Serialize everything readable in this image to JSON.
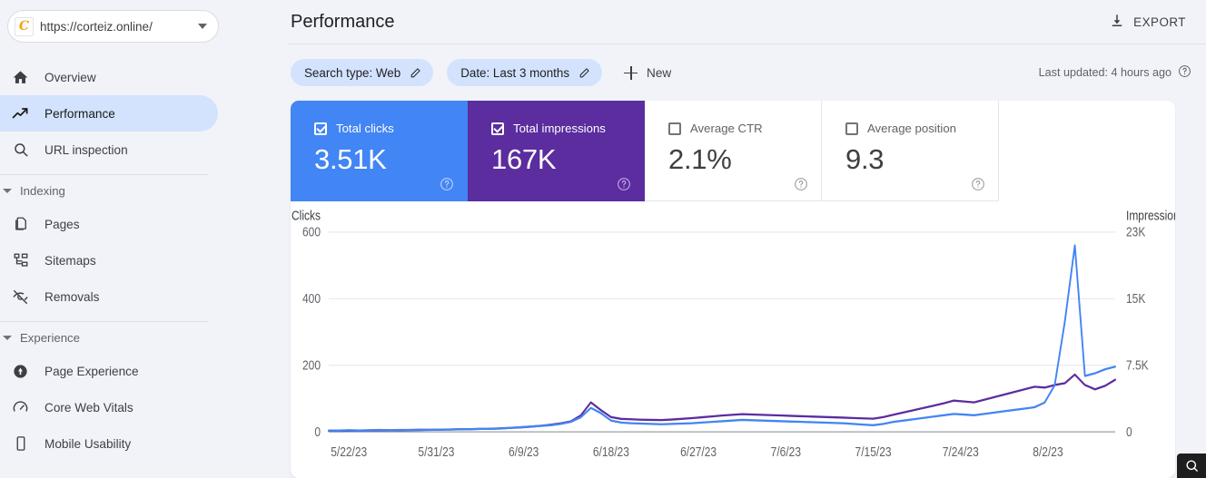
{
  "sidebar": {
    "property": {
      "url": "https://corteiz.online/",
      "favicon_letter": "C",
      "dropdown_icon": "chevron-down-icon"
    },
    "items": [
      {
        "label": "Overview",
        "icon": "home-icon",
        "active": false
      },
      {
        "label": "Performance",
        "icon": "trending-up-icon",
        "active": true
      },
      {
        "label": "URL inspection",
        "icon": "search-icon",
        "active": false
      }
    ],
    "groups": [
      {
        "label": "Indexing",
        "items": [
          {
            "label": "Pages",
            "icon": "pages-icon"
          },
          {
            "label": "Sitemaps",
            "icon": "sitemap-icon"
          },
          {
            "label": "Removals",
            "icon": "eye-off-icon"
          }
        ]
      },
      {
        "label": "Experience",
        "items": [
          {
            "label": "Page Experience",
            "icon": "page-experience-icon"
          },
          {
            "label": "Core Web Vitals",
            "icon": "speedometer-icon"
          },
          {
            "label": "Mobile Usability",
            "icon": "mobile-icon"
          }
        ]
      }
    ]
  },
  "header": {
    "title": "Performance",
    "export_label": "EXPORT",
    "export_icon": "download-icon"
  },
  "filters": {
    "chips": [
      {
        "label": "Search type: Web",
        "icon": "pencil-icon"
      },
      {
        "label": "Date: Last 3 months",
        "icon": "pencil-icon"
      }
    ],
    "new_label": "New",
    "new_icon": "plus-icon",
    "last_updated": "Last updated: 4 hours ago",
    "help_icon": "help-circle-icon"
  },
  "metrics": [
    {
      "label": "Total clicks",
      "value": "3.51K",
      "checked": true,
      "state": "sel-blue"
    },
    {
      "label": "Total impressions",
      "value": "167K",
      "checked": true,
      "state": "sel-purple"
    },
    {
      "label": "Average CTR",
      "value": "2.1%",
      "checked": false,
      "state": ""
    },
    {
      "label": "Average position",
      "value": "9.3",
      "checked": false,
      "state": ""
    }
  ],
  "colors": {
    "clicks": "#4285F4",
    "impressions": "#5B2D9E",
    "card_blue": "#4285F4",
    "card_purple": "#5B2D9E",
    "chip_bg": "#D3E3FD",
    "page_bg": "#F1F3F9"
  },
  "chart_data": {
    "type": "line",
    "title": "",
    "ylabel": "Clicks",
    "y2label": "Impressions",
    "xlabel": "",
    "ylim": [
      0,
      600
    ],
    "y2lim": [
      0,
      23000
    ],
    "yticks": [
      "0",
      "200",
      "400",
      "600"
    ],
    "y2ticks": [
      "0",
      "7.5K",
      "15K",
      "23K"
    ],
    "grid": true,
    "legend": "none",
    "xticks": [
      "5/22/23",
      "5/31/23",
      "6/9/23",
      "6/18/23",
      "6/27/23",
      "7/6/23",
      "7/15/23",
      "7/24/23",
      "8/2/23"
    ],
    "x_start": "5/22/23",
    "x_end": "8/8/23",
    "n_points": 79,
    "series": [
      {
        "name": "Clicks",
        "color": "#4285F4",
        "axis": "left",
        "values": [
          4,
          4,
          5,
          4,
          5,
          6,
          5,
          6,
          6,
          7,
          6,
          7,
          7,
          8,
          8,
          9,
          9,
          10,
          12,
          14,
          16,
          18,
          20,
          24,
          30,
          44,
          72,
          56,
          34,
          28,
          26,
          25,
          24,
          23,
          24,
          25,
          26,
          28,
          30,
          32,
          34,
          36,
          35,
          34,
          33,
          32,
          31,
          30,
          29,
          28,
          27,
          26,
          24,
          22,
          20,
          24,
          30,
          34,
          38,
          42,
          46,
          50,
          54,
          52,
          50,
          54,
          58,
          62,
          66,
          70,
          74,
          88,
          140,
          330,
          560,
          168,
          176,
          188,
          196
        ]
      },
      {
        "name": "Impressions",
        "color": "#5B2D9E",
        "axis": "right",
        "values": [
          120,
          130,
          140,
          150,
          160,
          170,
          180,
          190,
          200,
          220,
          240,
          260,
          280,
          300,
          320,
          340,
          360,
          400,
          460,
          520,
          600,
          700,
          820,
          980,
          1200,
          1900,
          3400,
          2500,
          1700,
          1500,
          1450,
          1400,
          1380,
          1360,
          1420,
          1500,
          1580,
          1680,
          1780,
          1880,
          1960,
          2040,
          2000,
          1960,
          1920,
          1880,
          1840,
          1800,
          1760,
          1720,
          1680,
          1640,
          1600,
          1560,
          1520,
          1700,
          1980,
          2240,
          2500,
          2760,
          3020,
          3300,
          3600,
          3500,
          3400,
          3700,
          4000,
          4300,
          4600,
          4900,
          5200,
          5100,
          5400,
          5600,
          6600,
          5400,
          4900,
          5300,
          6000
        ]
      }
    ]
  }
}
